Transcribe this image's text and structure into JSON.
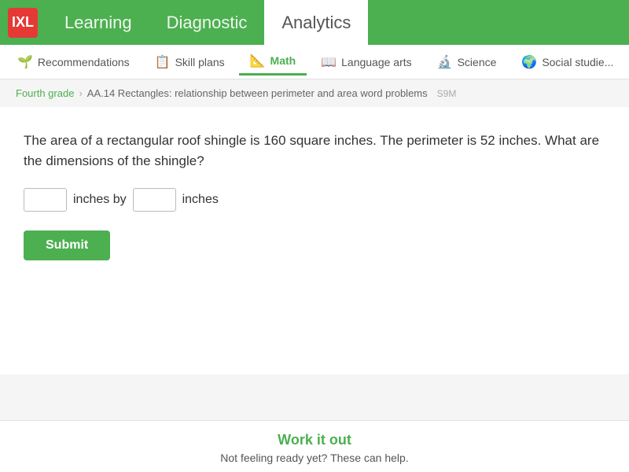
{
  "topnav": {
    "logo_text": "IXL",
    "links": [
      {
        "id": "learning",
        "label": "Learning",
        "active": false
      },
      {
        "id": "diagnostic",
        "label": "Diagnostic",
        "active": false
      },
      {
        "id": "analytics",
        "label": "Analytics",
        "active": false
      }
    ]
  },
  "subnav": {
    "items": [
      {
        "id": "recommendations",
        "label": "Recommendations",
        "icon": "🌱",
        "active": false
      },
      {
        "id": "skill-plans",
        "label": "Skill plans",
        "icon": "📋",
        "active": false
      },
      {
        "id": "math",
        "label": "Math",
        "icon": "📐",
        "active": true
      },
      {
        "id": "language-arts",
        "label": "Language arts",
        "icon": "📖",
        "active": false
      },
      {
        "id": "science",
        "label": "Science",
        "icon": "🔬",
        "active": false
      },
      {
        "id": "social-studies",
        "label": "Social studie...",
        "icon": "🌍",
        "active": false
      }
    ]
  },
  "breadcrumb": {
    "grade": "Fourth grade",
    "separator": "›",
    "current": "AA.14 Rectangles: relationship between perimeter and area word problems",
    "code": "S9M"
  },
  "question": {
    "text": "The area of a rectangular roof shingle is 160 square inches. The perimeter is 52 inches. What are the dimensions of the shingle?",
    "input1_placeholder": "",
    "input2_placeholder": "",
    "between_label": "inches by",
    "after_label": "inches"
  },
  "submit_button": {
    "label": "Submit"
  },
  "bottom": {
    "title": "Work it out",
    "subtitle": "Not feeling ready yet? These can help."
  }
}
